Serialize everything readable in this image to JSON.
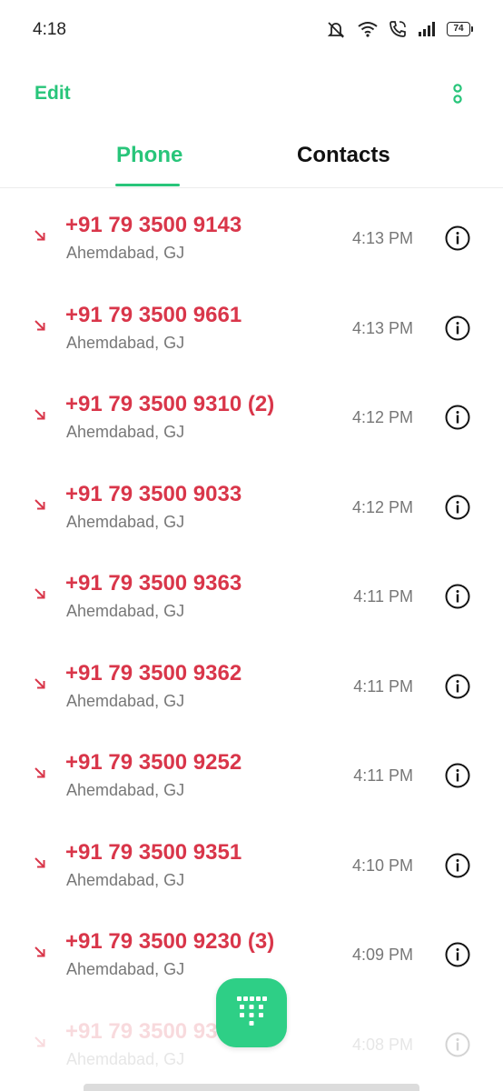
{
  "status_bar": {
    "time": "4:18",
    "battery": "74"
  },
  "header": {
    "edit_label": "Edit"
  },
  "tabs": [
    {
      "label": "Phone"
    },
    {
      "label": "Contacts"
    }
  ],
  "calls": [
    {
      "number": "+91 79 3500 9143",
      "location": "Ahemdabad, GJ",
      "time": "4:13 PM"
    },
    {
      "number": "+91 79 3500 9661",
      "location": "Ahemdabad, GJ",
      "time": "4:13 PM"
    },
    {
      "number": "+91 79 3500 9310 (2)",
      "location": "Ahemdabad, GJ",
      "time": "4:12 PM"
    },
    {
      "number": "+91 79 3500 9033",
      "location": "Ahemdabad, GJ",
      "time": "4:12 PM"
    },
    {
      "number": "+91 79 3500 9363",
      "location": "Ahemdabad, GJ",
      "time": "4:11 PM"
    },
    {
      "number": "+91 79 3500 9362",
      "location": "Ahemdabad, GJ",
      "time": "4:11 PM"
    },
    {
      "number": "+91 79 3500 9252",
      "location": "Ahemdabad, GJ",
      "time": "4:11 PM"
    },
    {
      "number": "+91 79 3500 9351",
      "location": "Ahemdabad, GJ",
      "time": "4:10 PM"
    },
    {
      "number": "+91 79 3500 9230 (3)",
      "location": "Ahemdabad, GJ",
      "time": "4:09 PM"
    },
    {
      "number": "+91 79 3500 93",
      "location": "Ahemdabad, GJ",
      "time": "4:08 PM"
    }
  ],
  "colors": {
    "accent": "#28c57a",
    "missed_call": "#d9364a"
  },
  "icons": {
    "missed_call": "missed-call-arrow-icon",
    "info": "info-icon",
    "dialpad": "dialpad-icon",
    "more": "more-options-icon"
  }
}
